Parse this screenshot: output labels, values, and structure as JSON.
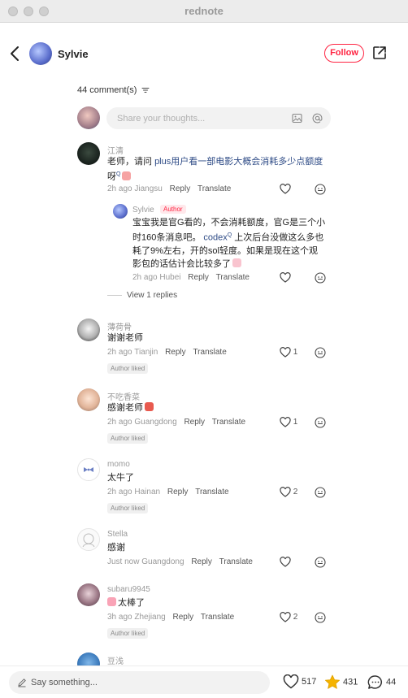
{
  "window": {
    "title": "rednote"
  },
  "post": {
    "author": "Sylvie",
    "follow_label": "Follow"
  },
  "comments_header": {
    "count_label": "44 comment(s)",
    "input_placeholder": "Share your thoughts..."
  },
  "comments": [
    {
      "name": "江清",
      "text_plain": "老师，请问 ",
      "text_link": "plus用户看一部电影大概会消耗多少点额度",
      "text_tail": "呀",
      "time": "2h ago",
      "location": "Jiangsu",
      "reply_label": "Reply",
      "translate_label": "Translate",
      "likes": "",
      "reply": {
        "name": "Sylvie",
        "badge": "Author",
        "line1": "宝宝我是官G看的，不会消耗额度，官G是三个小",
        "line2a": "时160条消息吧。 ",
        "line2b": "codex",
        "line2c": " 上次后台没做这么多也",
        "line3": "耗了9%左右，开的sol轻度。如果是现在这个观",
        "line4": "影包的话估计会比较多了",
        "time": "2h ago",
        "location": "Hubei",
        "reply_label": "Reply",
        "translate_label": "Translate"
      },
      "view_replies": "View 1 replies"
    },
    {
      "name": "薄荷骨",
      "text": "谢谢老师",
      "time": "2h ago",
      "location": "Tianjin",
      "reply_label": "Reply",
      "translate_label": "Translate",
      "likes": "1",
      "badge": "Author liked"
    },
    {
      "name": "不吃香菜",
      "text": "感谢老师",
      "time": "2h ago",
      "location": "Guangdong",
      "reply_label": "Reply",
      "translate_label": "Translate",
      "likes": "1",
      "badge": "Author liked"
    },
    {
      "name": "momo",
      "text": "太牛了",
      "time": "2h ago",
      "location": "Hainan",
      "reply_label": "Reply",
      "translate_label": "Translate",
      "likes": "2",
      "badge": "Author liked"
    },
    {
      "name": "Stella",
      "text": "感谢",
      "time": "Just now",
      "location": "Guangdong",
      "reply_label": "Reply",
      "translate_label": "Translate",
      "likes": ""
    },
    {
      "name": "subaru9945",
      "text": "太棒了",
      "time": "3h ago",
      "location": "Zhejiang",
      "reply_label": "Reply",
      "translate_label": "Translate",
      "likes": "2",
      "badge": "Author liked"
    },
    {
      "name": "豆浅"
    }
  ],
  "bottom_bar": {
    "input_placeholder": "Say something...",
    "likes": "517",
    "stars": "431",
    "comments": "44"
  },
  "colors": {
    "brand": "#ff2442",
    "link": "#2e4b86",
    "star": "#f5b300"
  }
}
